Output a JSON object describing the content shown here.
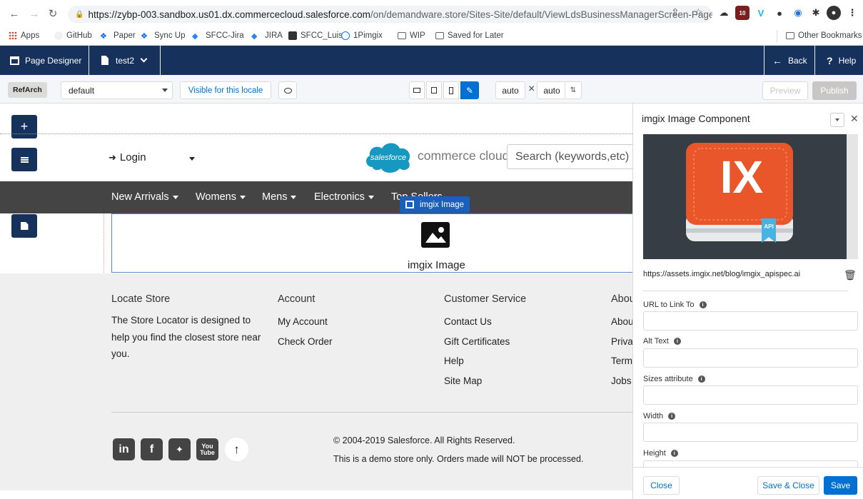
{
  "browser": {
    "url_host": "https://zybp-003.sandbox.us01.dx.commercecloud.salesforce.com",
    "url_path": "/on/demandware.store/Sites-Site/default/ViewLdsBusinessManagerScreen-PageDe...",
    "bookmarks": [
      "Apps",
      "GitHub",
      "Paper",
      "Sync Up",
      "SFCC-Jira",
      "JIRA",
      "SFCC_Luis",
      "1Pimgix",
      "WIP",
      "Saved for Later"
    ],
    "other_bookmarks": "Other Bookmarks",
    "ext_badge": "10"
  },
  "designer": {
    "app_name": "Page Designer",
    "page_name": "test2",
    "back_label": "Back",
    "help_label": "Help"
  },
  "toolbar": {
    "site_badge": "RefArch",
    "locale_value": "default",
    "visible_label": "Visible for this locale",
    "width_value": "auto",
    "height_value": "auto",
    "preview_label": "Preview",
    "publish_label": "Publish"
  },
  "store": {
    "login_label": "Login",
    "logo_text": "salesforce",
    "brand_text": "commerce cloud",
    "search_placeholder": "Search (keywords,etc)",
    "nav": [
      "New Arrivals",
      "Womens",
      "Mens",
      "Electronics",
      "Top Sellers"
    ],
    "component_tag": "imgix Image",
    "component_label": "imgix Image",
    "footer": {
      "locate_title": "Locate Store",
      "locate_desc": "The Store Locator is designed to help you find the closest store near you.",
      "account_title": "Account",
      "account_links": [
        "My Account",
        "Check Order"
      ],
      "service_title": "Customer Service",
      "service_links": [
        "Contact Us",
        "Gift Certificates",
        "Help",
        "Site Map"
      ],
      "about_title": "About",
      "about_links": [
        "About",
        "Privacy",
        "Terms",
        "Jobs"
      ],
      "copyright": "© 2004-2019 Salesforce. All Rights Reserved.",
      "demo_notice": "This is a demo store only. Orders made will NOT be processed."
    }
  },
  "panel": {
    "title": "imgix Image Component",
    "image_url": "https://assets.imgix.net/blog/imgix_apispec.ai",
    "image_big_text": "IX",
    "image_small_text": "API",
    "fields": [
      "URL to Link To",
      "Alt Text",
      "Sizes attribute",
      "Width",
      "Height"
    ],
    "close_label": "Close",
    "save_close_label": "Save & Close",
    "save_label": "Save"
  },
  "colors": {
    "header_navy": "#16325c",
    "salesforce_blue": "#0070d2",
    "book_orange": "#e8562a"
  }
}
